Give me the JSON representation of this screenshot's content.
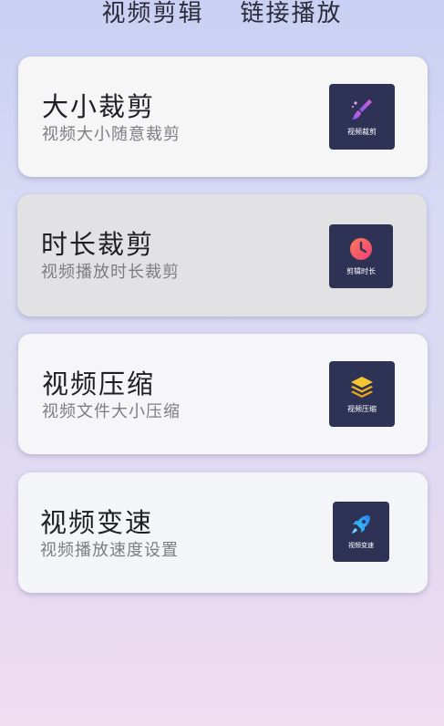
{
  "tabs": [
    "视频剪辑",
    "链接播放"
  ],
  "cards": [
    {
      "title": "大小裁剪",
      "subtitle": "视频大小随意裁剪",
      "icon_label": "视频裁剪",
      "icon": "brush-icon"
    },
    {
      "title": "时长裁剪",
      "subtitle": "视频播放时长裁剪",
      "icon_label": "剪辑时长",
      "icon": "clock-icon"
    },
    {
      "title": "视频压缩",
      "subtitle": "视频文件大小压缩",
      "icon_label": "视频压缩",
      "icon": "layers-icon"
    },
    {
      "title": "视频变速",
      "subtitle": "视频播放速度设置",
      "icon_label": "视频变速",
      "icon": "rocket-icon"
    }
  ],
  "colors": {
    "tile_bg": "#2e3356",
    "clock": "#f0506e",
    "layers": "#f5b621",
    "rocket": "#2fa6f0",
    "brush": "#b45cf0"
  }
}
